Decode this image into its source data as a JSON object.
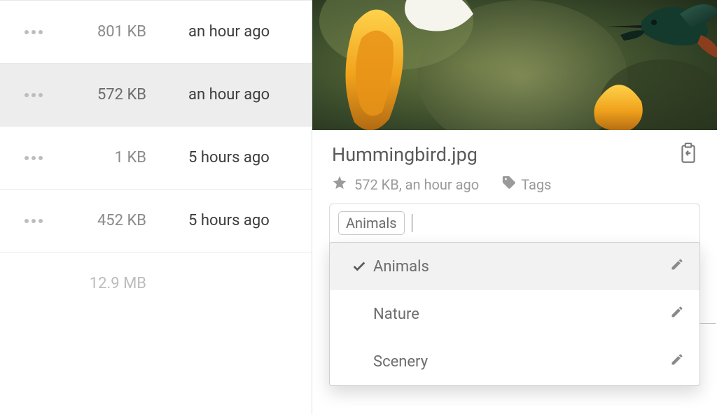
{
  "list": {
    "rows": [
      {
        "size": "801 KB",
        "time": "an hour ago",
        "selected": false
      },
      {
        "size": "572 KB",
        "time": "an hour ago",
        "selected": true
      },
      {
        "size": "1 KB",
        "time": "5 hours ago",
        "selected": false
      },
      {
        "size": "452 KB",
        "time": "5 hours ago",
        "selected": false
      }
    ],
    "total": "12.9 MB"
  },
  "detail": {
    "filename": "Hummingbird.jpg",
    "meta_text": "572 KB, an hour ago",
    "tags_label": "Tags",
    "chip": "Animals",
    "options": [
      {
        "label": "Animals",
        "selected": true
      },
      {
        "label": "Nature",
        "selected": false
      },
      {
        "label": "Scenery",
        "selected": false
      }
    ]
  }
}
